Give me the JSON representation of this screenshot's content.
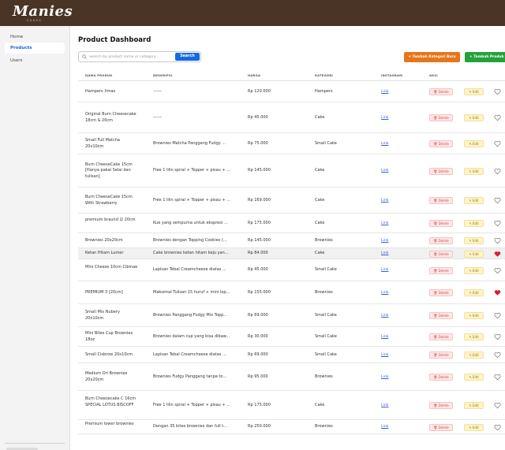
{
  "app": {
    "logo": "Manies",
    "logo_sub": "CAKES"
  },
  "sidebar": {
    "items": [
      {
        "label": "Home",
        "active": false
      },
      {
        "label": "Products",
        "active": true
      },
      {
        "label": "Users",
        "active": false
      }
    ]
  },
  "header": {
    "title": "Product Dashboard"
  },
  "search": {
    "placeholder": "Search by product name or category...",
    "value": "",
    "button_label": "Search"
  },
  "actions": {
    "add_category_label": "+ Tambah Kategori Baru",
    "add_product_label": "+ Tambah Produk"
  },
  "colors": {
    "topbar": "#4a3426",
    "accent": "#1769e0",
    "orange": "#e8751a",
    "green": "#23a23a",
    "delete": "#e24848",
    "edit": "#9c7a00",
    "heart_active": "#e0192e"
  },
  "table": {
    "columns": [
      "NAMA PRODUK",
      "DESKRIPSI",
      "HARGA",
      "KATEGORI",
      "INSTAGRAM",
      "AKSI"
    ],
    "delete_label": "🗑 Delete",
    "edit_label": "✎ Edit",
    "rows": [
      {
        "name": "Hampers Xmas",
        "description": "------",
        "price": "Rp 120.000",
        "category": "Hampers",
        "instagram": "Link",
        "favorite": false,
        "highlight": false
      },
      {
        "name": "Original Burn Cheesecake 18cm & 20cm",
        "description": "------",
        "price": "Rp 45.000",
        "category": "Cake",
        "instagram": "Link",
        "favorite": false,
        "highlight": false
      },
      {
        "name": "Small Full Matcha 20x10cm",
        "description": "Brownies Matcha Panggang Fudgy ...",
        "price": "Rp 75.000",
        "category": "Small Cake",
        "instagram": "Link",
        "favorite": false,
        "highlight": false
      },
      {
        "name": "Burn CheeseCake 15cm [Hanya pakai Selai dan tulisan]",
        "description": "Free 1 lilin spiral + Topper + pisau + ...",
        "price": "Rp 145.000",
        "category": "Cake",
        "instagram": "Link",
        "favorite": false,
        "highlight": false
      },
      {
        "name": "Burn CheeseCake 15cm With Strawberry",
        "description": "Free 1 lilin spiral + Topper + pisau + ...",
        "price": "Rp 169.000",
        "category": "Cake",
        "instagram": "Link",
        "favorite": false,
        "highlight": false
      },
      {
        "name": "premium braund l2 20cm",
        "description": "Kue yang sempurna untuk ekspresi ...",
        "price": "Rp 175.000",
        "category": "Cake",
        "instagram": "Link",
        "favorite": false,
        "highlight": false
      },
      {
        "name": "Brownies 20x20cm",
        "description": "Brownies dengan Topping Cookies (...",
        "price": "Rp 145.000",
        "category": "Brownies",
        "instagram": "Link",
        "favorite": false,
        "highlight": false
      },
      {
        "name": "Ketan Hitam Lumer",
        "description": "Cake brownies ketan hitam keju yan...",
        "price": "Rp 84.000",
        "category": "Cake",
        "instagram": "Link",
        "favorite": true,
        "highlight": true
      },
      {
        "name": "Mini Cheese 10cm Cibinae",
        "description": "Lapisan Tebal Creamcheese diatas ...",
        "price": "Rp 45.000",
        "category": "Small Cake",
        "instagram": "Link",
        "favorite": false,
        "highlight": false
      },
      {
        "name": "PREMIUM 3 [20cm]",
        "description": "Maksimal Tulisan 15 huruf + mini lop...",
        "price": "Rp 155.000",
        "category": "Brownies",
        "instagram": "Link",
        "favorite": true,
        "highlight": false
      },
      {
        "name": "Small Mix Nubery 20x10cm",
        "description": "Brownies Panggang Fudgy Mix Topp...",
        "price": "Rp 69.000",
        "category": "Small Cake",
        "instagram": "Link",
        "favorite": false,
        "highlight": false
      },
      {
        "name": "Mini Bites Cup Brownies 18oz",
        "description": "Brownies dalam cup yang bisa dibaw...",
        "price": "Rp 30.000",
        "category": "Small Cake",
        "instagram": "Link",
        "favorite": false,
        "highlight": false
      },
      {
        "name": "Small Cisbrow 20x10cm",
        "description": "Lapisan Tebal Creamcheese diatas ...",
        "price": "Rp 69.000",
        "category": "Small Cake",
        "instagram": "Link",
        "favorite": false,
        "highlight": false
      },
      {
        "name": "Medium Ori Brownies 20x20cm",
        "description": "Brownies Fudgy Panggang tanpa to...",
        "price": "Rp 95.000",
        "category": "Brownies",
        "instagram": "Link",
        "favorite": false,
        "highlight": false
      },
      {
        "name": "Burn Cheesecake C 16cm SPECIAL LOTUS BISCOFF",
        "description": "Free 1 lilin spiral + Topper + pisau + ...",
        "price": "Rp 175.000",
        "category": "Cake",
        "instagram": "Link",
        "favorite": false,
        "highlight": false
      },
      {
        "name": "Premium lower brownies",
        "description": "Dengan 35 bites brownies dan full t...",
        "price": "Rp 250.000",
        "category": "Brownies",
        "instagram": "Link",
        "favorite": false,
        "highlight": false
      }
    ]
  }
}
